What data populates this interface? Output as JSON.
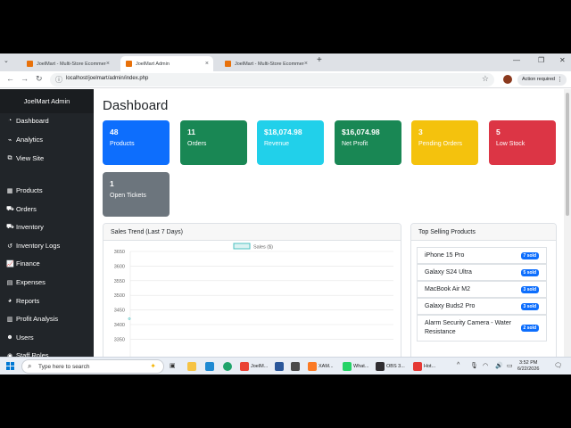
{
  "browser": {
    "tabs": [
      {
        "title": "JoelMart - Multi-Store Ecommerce",
        "active": false
      },
      {
        "title": "JoelMart Admin",
        "active": true
      },
      {
        "title": "JoelMart - Multi-Store Ecommerce",
        "active": false
      }
    ],
    "url": "localhost/joelmart/admin/index.php",
    "action_required": "Action required"
  },
  "sidebar": {
    "brand": "JoelMart Admin",
    "items": [
      {
        "label": "Dashboard",
        "icon": "speedometer-icon"
      },
      {
        "label": "Analytics",
        "icon": "graph-icon"
      },
      {
        "label": "View Site",
        "icon": "external-link-icon"
      },
      {
        "label": "Products",
        "icon": "box-icon"
      },
      {
        "label": "Orders",
        "icon": "cart-icon"
      },
      {
        "label": "Inventory",
        "icon": "truck-icon"
      },
      {
        "label": "Inventory Logs",
        "icon": "history-icon"
      },
      {
        "label": "Finance",
        "icon": "line-chart-icon"
      },
      {
        "label": "Expenses",
        "icon": "wallet-icon"
      },
      {
        "label": "Reports",
        "icon": "pie-chart-icon"
      },
      {
        "label": "Profit Analysis",
        "icon": "bar-chart-icon"
      },
      {
        "label": "Users",
        "icon": "users-icon"
      },
      {
        "label": "Staff Roles",
        "icon": "person-badge-icon"
      }
    ]
  },
  "dashboard": {
    "title": "Dashboard",
    "cards": [
      {
        "value": "48",
        "label": "Products",
        "color": "#0d6efd"
      },
      {
        "value": "11",
        "label": "Orders",
        "color": "#198754"
      },
      {
        "value": "$18,074.98",
        "label": "Revenue",
        "color": "#21d0ea"
      },
      {
        "value": "$16,074.98",
        "label": "Net Profit",
        "color": "#198754"
      },
      {
        "value": "3",
        "label": "Pending Orders",
        "color": "#f4c20d"
      },
      {
        "value": "5",
        "label": "Low Stock",
        "color": "#dc3545"
      },
      {
        "value": "1",
        "label": "Open Tickets",
        "color": "#6c757d"
      }
    ]
  },
  "sales_trend": {
    "header": "Sales Trend (Last 7 Days)"
  },
  "chart_data": {
    "type": "line",
    "series": [
      {
        "name": "Sales ($)",
        "values": [
          3420
        ]
      }
    ],
    "yticks": [
      3650,
      3600,
      3550,
      3500,
      3450,
      3400,
      3350
    ],
    "ylim": [
      3350,
      3650
    ],
    "legend": "top",
    "grid": true,
    "color": "#4bc0c0"
  },
  "top_selling": {
    "header": "Top Selling Products",
    "items": [
      {
        "name": "iPhone 15 Pro",
        "sold": "7 sold"
      },
      {
        "name": "Galaxy S24 Ultra",
        "sold": "5 sold"
      },
      {
        "name": "MacBook Air M2",
        "sold": "3 sold"
      },
      {
        "name": "Galaxy Buds2 Pro",
        "sold": "3 sold"
      },
      {
        "name": "Alarm Security Camera - Water Resistance",
        "sold": "2 sold"
      }
    ]
  },
  "taskbar": {
    "search_placeholder": "Type here to search",
    "apps": [
      {
        "label": "JoelM...",
        "color": "#ea4335"
      },
      {
        "label": "XAM...",
        "color": "#fb7a24"
      },
      {
        "label": "What...",
        "color": "#25d366"
      },
      {
        "label": "OBS 3...",
        "color": "#302e31"
      },
      {
        "label": "Hot...",
        "color": "#e53935"
      }
    ],
    "time": "3:52 PM",
    "date": "6/22/2026"
  }
}
